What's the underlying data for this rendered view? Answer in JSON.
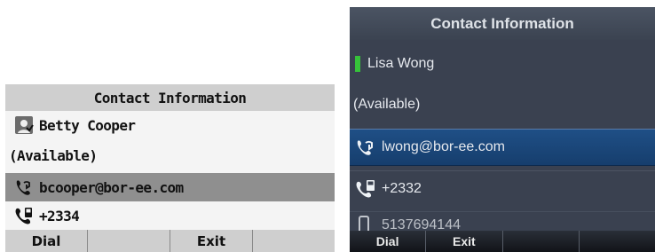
{
  "left_screen": {
    "title": "Contact Information",
    "contact": {
      "name": "Betty Cooper",
      "status": "(Available)",
      "email": "bcooper@bor-ee.com",
      "phone": "+2334"
    },
    "softkeys": [
      "Dial",
      "",
      "Exit",
      ""
    ],
    "icons": [
      "contact-card-icon",
      "call-email-icon",
      "phone-icon"
    ]
  },
  "right_screen": {
    "title": "Contact Information",
    "contact": {
      "name": "Lisa Wong",
      "status": "(Available)",
      "email": "lwong@bor-ee.com",
      "phone": "+2332",
      "more_partial": "5137694144"
    },
    "presence_color": "#36c23a",
    "highlight_color": "#1f4f86",
    "softkeys": [
      "Dial",
      "Exit",
      "",
      ""
    ],
    "icons": [
      "presence-indicator",
      "call-email-icon",
      "phone-icon",
      "mobile-phone-icon"
    ]
  }
}
